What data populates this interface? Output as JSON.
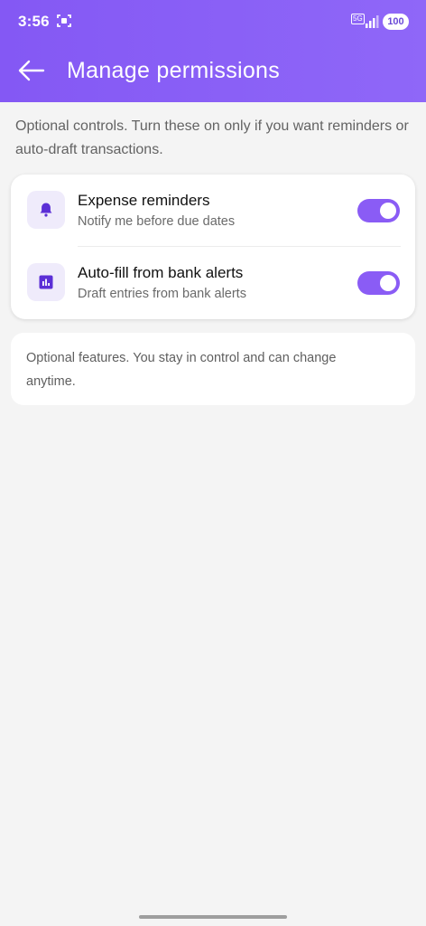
{
  "status_bar": {
    "time": "3:56",
    "network": "5G",
    "battery": "100"
  },
  "app_bar": {
    "title": "Manage permissions",
    "back_icon": "arrow-left-icon"
  },
  "intro_text": "Optional controls. Turn these on only if you want reminders or auto-draft transactions.",
  "permissions": [
    {
      "icon": "bell-icon",
      "label": "Expense reminders",
      "description": "Notify me before due dates",
      "enabled": true
    },
    {
      "icon": "bar-chart-icon",
      "label": "Auto-fill from bank alerts",
      "description": "Draft entries from bank alerts",
      "enabled": true
    }
  ],
  "footer_note": "Optional features. You stay in control and can change anytime.",
  "colors": {
    "accent": "#8a5cf5",
    "header": "#8458f4",
    "background": "#f4f4f4"
  }
}
